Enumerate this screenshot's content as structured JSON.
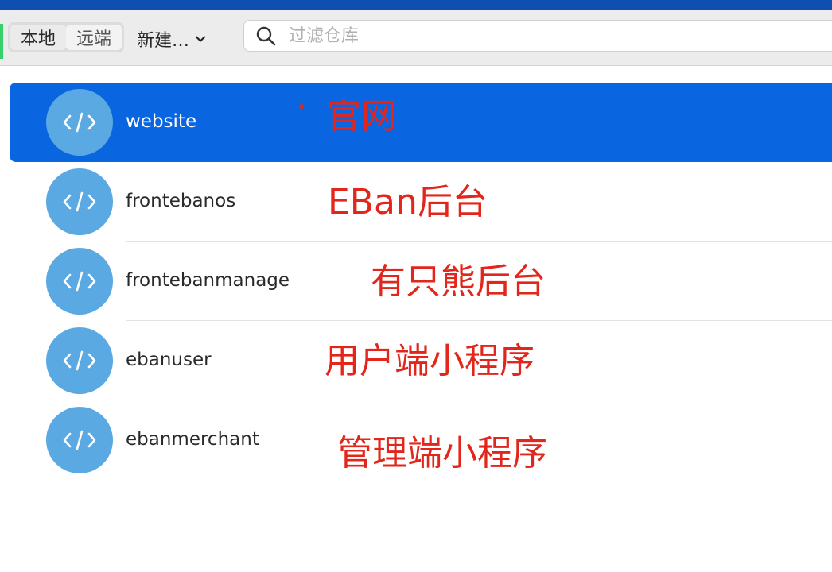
{
  "toolbar": {
    "tabs": [
      {
        "label": "本地",
        "active": true
      },
      {
        "label": "远端",
        "active": false
      }
    ],
    "new_menu": {
      "label": "新建…"
    },
    "search": {
      "placeholder": "过滤仓库",
      "value": ""
    }
  },
  "repositories": [
    {
      "name": "website",
      "selected": true
    },
    {
      "name": "frontebanos",
      "selected": false
    },
    {
      "name": "frontebanmanage",
      "selected": false
    },
    {
      "name": "ebanuser",
      "selected": false
    },
    {
      "name": "ebanmerchant",
      "selected": false
    }
  ],
  "annotations": [
    {
      "text": "官网"
    },
    {
      "text": "EBan后台"
    },
    {
      "text": "有只熊后台"
    },
    {
      "text": "用户端小程序"
    },
    {
      "text": "管理端小程序"
    }
  ],
  "colors": {
    "accent": "#0a66e0",
    "avatar": "#5aa9e2",
    "annotation": "#e3261b",
    "topbar": "#0f4fb0"
  }
}
